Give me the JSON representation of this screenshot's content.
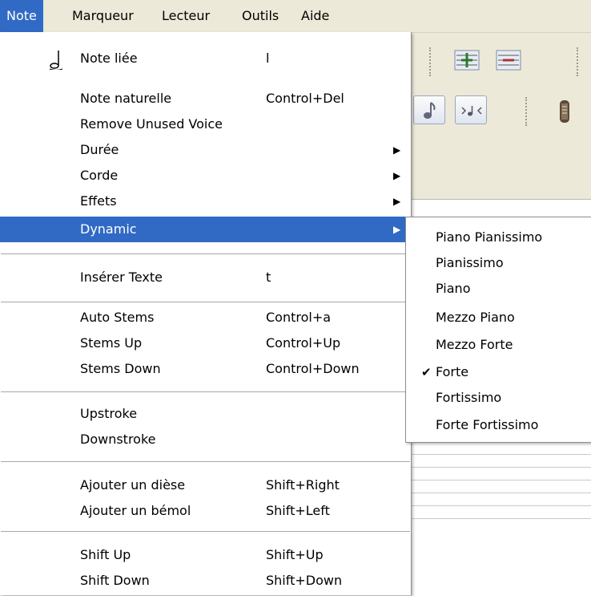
{
  "menubar": {
    "items": [
      {
        "label": "Note",
        "active": true
      },
      {
        "label": "Marqueur"
      },
      {
        "label": "Lecteur"
      },
      {
        "label": "Outils"
      },
      {
        "label": "Aide"
      }
    ]
  },
  "note_menu": {
    "items": [
      {
        "label": "Note liée",
        "shortcut": "l",
        "icon": "tied-note-icon"
      },
      {
        "label": "Note naturelle",
        "shortcut": "Control+Del"
      },
      {
        "label": "Remove Unused Voice",
        "shortcut": ""
      },
      {
        "label": "Durée",
        "submenu": true
      },
      {
        "label": "Corde",
        "submenu": true
      },
      {
        "label": "Effets",
        "submenu": true
      },
      {
        "label": "Dynamic",
        "submenu": true,
        "highlighted": true
      },
      {
        "label": "Insérer Texte",
        "shortcut": "t"
      },
      {
        "label": "Auto Stems",
        "shortcut": "Control+a"
      },
      {
        "label": "Stems Up",
        "shortcut": "Control+Up"
      },
      {
        "label": "Stems Down",
        "shortcut": "Control+Down"
      },
      {
        "label": "Upstroke",
        "shortcut": ""
      },
      {
        "label": "Downstroke",
        "shortcut": ""
      },
      {
        "label": "Ajouter un dièse",
        "shortcut": "Shift+Right"
      },
      {
        "label": "Ajouter un bémol",
        "shortcut": "Shift+Left"
      },
      {
        "label": "Shift Up",
        "shortcut": "Shift+Up"
      },
      {
        "label": "Shift Down",
        "shortcut": "Shift+Down"
      }
    ]
  },
  "dynamic_submenu": {
    "items": [
      {
        "label": "Piano Pianissimo"
      },
      {
        "label": "Pianissimo"
      },
      {
        "label": "Piano"
      },
      {
        "label": "Mezzo Piano"
      },
      {
        "label": "Mezzo Forte"
      },
      {
        "label": "Forte",
        "checked": true
      },
      {
        "label": "Fortissimo"
      },
      {
        "label": "Forte Fortissimo"
      }
    ]
  },
  "glyphs": {
    "submenu_arrow": "▶",
    "check": "✔"
  },
  "colors": {
    "highlight": "#316AC5",
    "menu_bg": "#FFFFFF",
    "chrome": "#ECE9D8"
  }
}
